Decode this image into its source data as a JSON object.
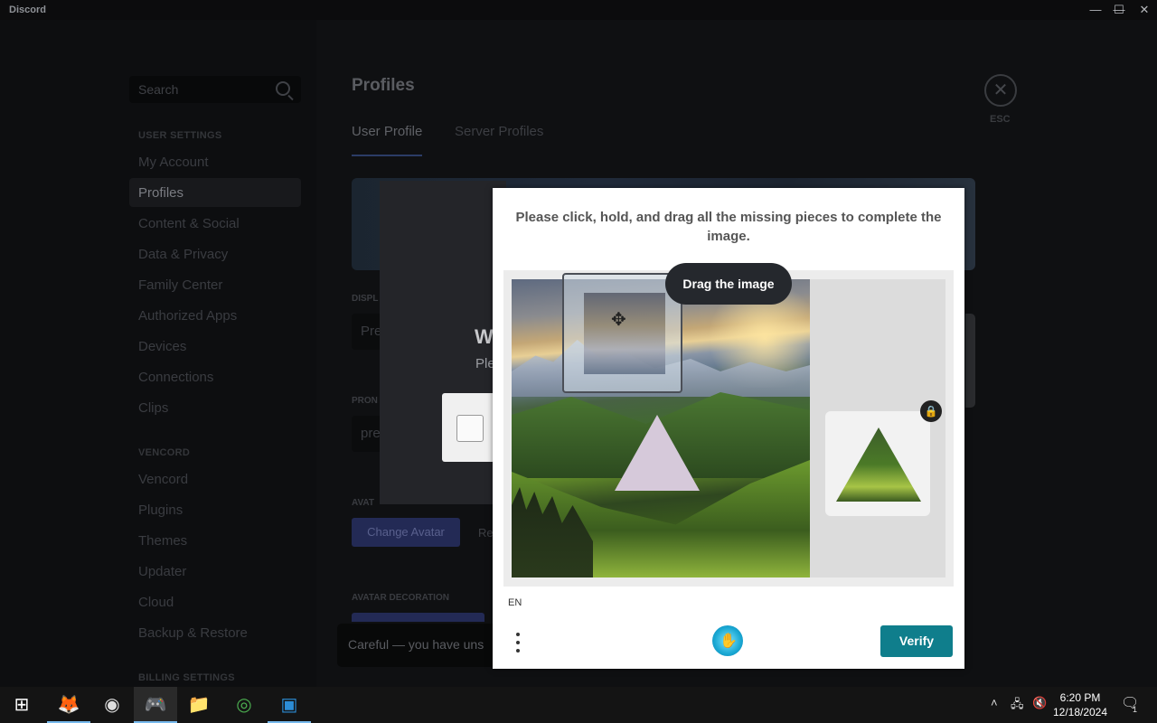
{
  "window": {
    "title": "Discord",
    "controls": [
      "—",
      "☐",
      "✕"
    ]
  },
  "sidebar": {
    "search_placeholder": "Search",
    "user_settings_header": "USER SETTINGS",
    "user_items": [
      "My Account",
      "Profiles",
      "Content & Social",
      "Data & Privacy",
      "Family Center",
      "Authorized Apps",
      "Devices",
      "Connections",
      "Clips"
    ],
    "vencord_header": "VENCORD",
    "vencord_items": [
      "Vencord",
      "Plugins",
      "Themes",
      "Updater",
      "Cloud",
      "Backup & Restore"
    ],
    "billing_header": "BILLING SETTINGS",
    "active_item": "Profiles"
  },
  "main": {
    "title": "Profiles",
    "tabs": [
      "User Profile",
      "Server Profiles"
    ],
    "active_tab": "User Profile",
    "display_name_label": "DISPL",
    "display_name_value": "Pre",
    "pronouns_label": "PRON",
    "pronouns_value": "pre",
    "avatar_label": "AVAT",
    "change_avatar": "Change Avatar",
    "remove_avatar": "Re",
    "avatar_decoration_label": "AVATAR DECORATION",
    "unsaved_warning": "Careful — you have uns",
    "esc_label": "ESC",
    "esc_icon": "close-icon"
  },
  "underlying_modal": {
    "title": "W",
    "subtitle": "Ple"
  },
  "captcha": {
    "prompt": "Please click, hold, and drag all the missing pieces to complete the image.",
    "tooltip": "Drag the image",
    "language": "EN",
    "verify_label": "Verify",
    "accent_color": "#0f7e8c"
  },
  "taskbar": {
    "time": "6:20 PM",
    "date": "12/18/2024",
    "notification_count": "1",
    "apps": [
      "windows-start",
      "metamask",
      "obs",
      "discord",
      "file-explorer",
      "chrome-canary",
      "remote-desktop"
    ]
  }
}
